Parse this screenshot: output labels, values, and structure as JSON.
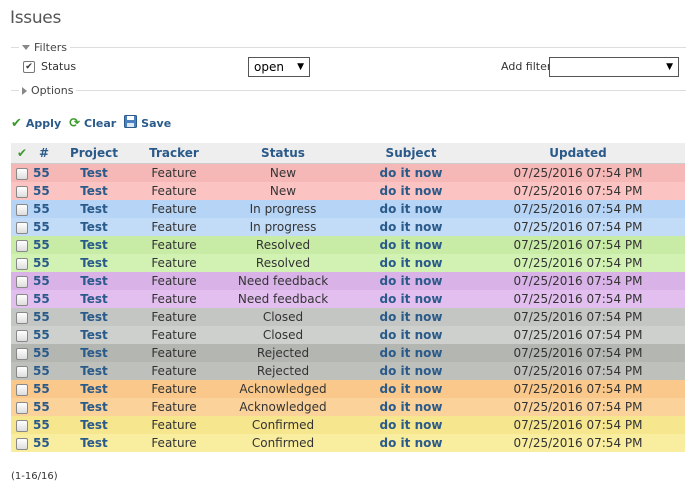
{
  "page": {
    "title": "Issues"
  },
  "filters": {
    "legend": "Filters",
    "status_label": "Status",
    "status_checked": true,
    "status_value": "open",
    "add_filter_label": "Add filter",
    "add_filter_value": ""
  },
  "options": {
    "legend": "Options"
  },
  "actions": {
    "apply": "Apply",
    "clear": "Clear",
    "save": "Save"
  },
  "table": {
    "columns": {
      "id": "#",
      "project": "Project",
      "tracker": "Tracker",
      "status": "Status",
      "subject": "Subject",
      "updated": "Updated"
    },
    "rows": [
      {
        "id": "55",
        "project": "Test",
        "tracker": "Feature",
        "status": "New",
        "subject": "do it now",
        "updated": "07/25/2016 07:54 PM",
        "color": "#f6b7b7"
      },
      {
        "id": "55",
        "project": "Test",
        "tracker": "Feature",
        "status": "New",
        "subject": "do it now",
        "updated": "07/25/2016 07:54 PM",
        "color": "#fcc3c3"
      },
      {
        "id": "55",
        "project": "Test",
        "tracker": "Feature",
        "status": "In progress",
        "subject": "do it now",
        "updated": "07/25/2016 07:54 PM",
        "color": "#b6d4f5"
      },
      {
        "id": "55",
        "project": "Test",
        "tracker": "Feature",
        "status": "In progress",
        "subject": "do it now",
        "updated": "07/25/2016 07:54 PM",
        "color": "#c2dcf8"
      },
      {
        "id": "55",
        "project": "Test",
        "tracker": "Feature",
        "status": "Resolved",
        "subject": "do it now",
        "updated": "07/25/2016 07:54 PM",
        "color": "#c8eca6"
      },
      {
        "id": "55",
        "project": "Test",
        "tracker": "Feature",
        "status": "Resolved",
        "subject": "do it now",
        "updated": "07/25/2016 07:54 PM",
        "color": "#d2f2b3"
      },
      {
        "id": "55",
        "project": "Test",
        "tracker": "Feature",
        "status": "Need feedback",
        "subject": "do it now",
        "updated": "07/25/2016 07:54 PM",
        "color": "#d9b2e8"
      },
      {
        "id": "55",
        "project": "Test",
        "tracker": "Feature",
        "status": "Need feedback",
        "subject": "do it now",
        "updated": "07/25/2016 07:54 PM",
        "color": "#e3bff0"
      },
      {
        "id": "55",
        "project": "Test",
        "tracker": "Feature",
        "status": "Closed",
        "subject": "do it now",
        "updated": "07/25/2016 07:54 PM",
        "color": "#c3c6c2"
      },
      {
        "id": "55",
        "project": "Test",
        "tracker": "Feature",
        "status": "Closed",
        "subject": "do it now",
        "updated": "07/25/2016 07:54 PM",
        "color": "#cdd0cc"
      },
      {
        "id": "55",
        "project": "Test",
        "tracker": "Feature",
        "status": "Rejected",
        "subject": "do it now",
        "updated": "07/25/2016 07:54 PM",
        "color": "#b4b6b2"
      },
      {
        "id": "55",
        "project": "Test",
        "tracker": "Feature",
        "status": "Rejected",
        "subject": "do it now",
        "updated": "07/25/2016 07:54 PM",
        "color": "#bec0bc"
      },
      {
        "id": "55",
        "project": "Test",
        "tracker": "Feature",
        "status": "Acknowledged",
        "subject": "do it now",
        "updated": "07/25/2016 07:54 PM",
        "color": "#f9c88a"
      },
      {
        "id": "55",
        "project": "Test",
        "tracker": "Feature",
        "status": "Acknowledged",
        "subject": "do it now",
        "updated": "07/25/2016 07:54 PM",
        "color": "#fbd29a"
      },
      {
        "id": "55",
        "project": "Test",
        "tracker": "Feature",
        "status": "Confirmed",
        "subject": "do it now",
        "updated": "07/25/2016 07:54 PM",
        "color": "#f6e68e"
      },
      {
        "id": "55",
        "project": "Test",
        "tracker": "Feature",
        "status": "Confirmed",
        "subject": "do it now",
        "updated": "07/25/2016 07:54 PM",
        "color": "#f9ed9f"
      }
    ]
  },
  "pagination": {
    "count": "(1-16/16)"
  },
  "icons": {
    "filters_toggle": "triangle-down-icon",
    "options_toggle": "triangle-right-icon",
    "apply": "checkmark-icon",
    "clear": "reload-icon",
    "save": "floppy-disk-icon"
  },
  "colors": {
    "link": "#2a5a8a",
    "header_bg": "#eeeeee"
  }
}
